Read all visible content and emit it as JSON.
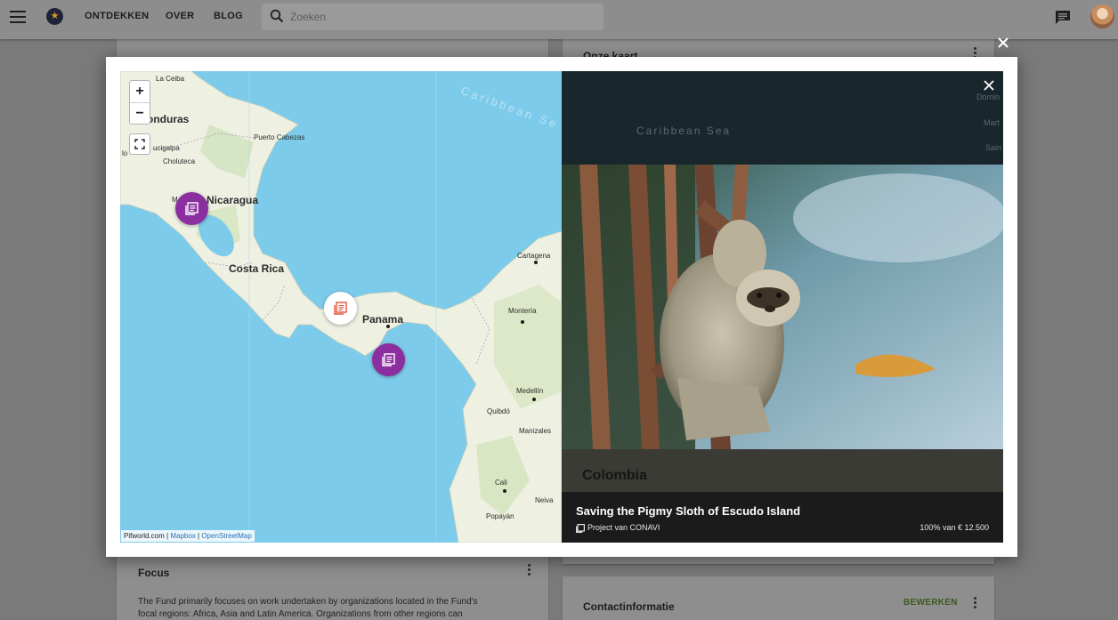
{
  "topbar": {
    "menu_icon": "menu-icon",
    "nav": [
      "ONTDEKKEN",
      "OVER",
      "BLOG"
    ],
    "search_placeholder": "Zoeken",
    "chat_icon": "chat-icon"
  },
  "background": {
    "map_card_title": "Onze kaart",
    "focus_title": "Focus",
    "focus_text_1": "The Fund primarily focuses on work undertaken by organizations located in the Fund's",
    "focus_text_2": "focal regions: Africa, Asia and Latin America. Organizations from other regions can",
    "contact_title": "Contactinformatie",
    "contact_edit": "BEWERKEN"
  },
  "map": {
    "zoom_in": "+",
    "zoom_out": "−",
    "labels": {
      "la_ceiba": "La Ceiba",
      "honduras": "onduras",
      "puerto_cabezas": "Puerto Cabezas",
      "tegucigalpa": "ucigalpa",
      "choluteca": "Choluteca",
      "nicaragua": "Nicaragua",
      "managua_m": "M",
      "costa_rica": "Costa Rica",
      "panama": "Panama",
      "cartagena": "Cartagena",
      "monteria": "Montería",
      "medellin": "Medellín",
      "quibdo": "Quibdó",
      "manizales": "Manizales",
      "cali": "Cali",
      "neiva": "Neiva",
      "popayan": "Popayán",
      "caribbean_sea": "Caribbean Se",
      "left_edge": "lo"
    },
    "attribution": {
      "pifworld": "Pifworld.com",
      "sep1": " | ",
      "mapbox": "Mapbox",
      "sep2": " | ",
      "osm": "OpenStreetMap"
    },
    "marker_colors": {
      "purple": "#8a2ea0",
      "selected": "#ffffff",
      "selected_icon": "#e0553a"
    }
  },
  "panel": {
    "bg_labels": {
      "caribbean": "Caribbean Sea",
      "domin": "Domin",
      "mart": "Mart",
      "sain": "Sain"
    },
    "country": "Colombia",
    "project_title": "Saving the Pigmy Sloth of Escudo Island",
    "project_by": "Project van CONAVI",
    "progress": "100% van € 12.500"
  }
}
